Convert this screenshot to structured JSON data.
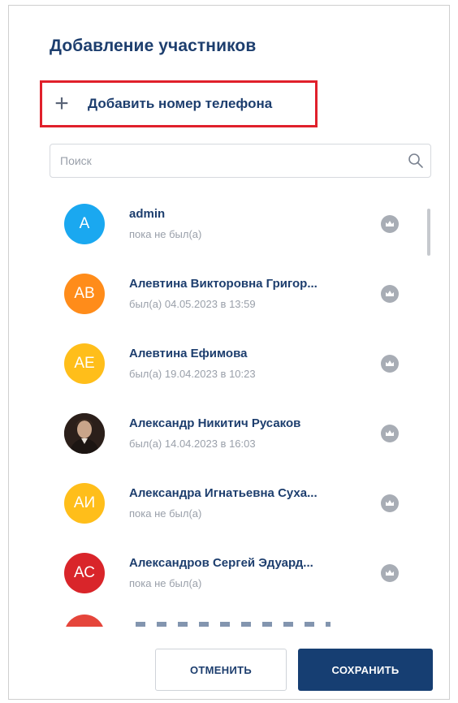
{
  "dialog": {
    "title": "Добавление участников",
    "add_phone": {
      "icon": "plus-icon",
      "label": "Добавить номер телефона"
    },
    "search": {
      "placeholder": "Поиск",
      "value": "",
      "icon": "search-icon"
    },
    "members": [
      {
        "initials": "A",
        "name": "admin",
        "status": "пока не был(а)",
        "avatar_color": "#1aa8f0"
      },
      {
        "initials": "АВ",
        "name": "Алевтина Викторовна Григор...",
        "status": "был(а) 04.05.2023 в 13:59",
        "avatar_color": "#ff8c1a"
      },
      {
        "initials": "АЕ",
        "name": "Алевтина Ефимова",
        "status": "был(а) 19.04.2023 в 10:23",
        "avatar_color": "#ffbe1a"
      },
      {
        "initials": "",
        "name": "Александр Никитич Русаков",
        "status": "был(а) 14.04.2023 в 16:03",
        "avatar_color": "#3a2a24"
      },
      {
        "initials": "АИ",
        "name": "Александра Игнатьевна Суха...",
        "status": "пока не был(а)",
        "avatar_color": "#ffbe1a"
      },
      {
        "initials": "АС",
        "name": "Александров Сергей Эдуард...",
        "status": "пока не был(а)",
        "avatar_color": "#d9252a"
      }
    ],
    "buttons": {
      "cancel": "ОТМЕНИТЬ",
      "save": "СОХРАНИТЬ"
    },
    "colors": {
      "accent": "#163e72",
      "highlight_border": "#e0202b",
      "crown_icon": "#a8adb5"
    }
  }
}
